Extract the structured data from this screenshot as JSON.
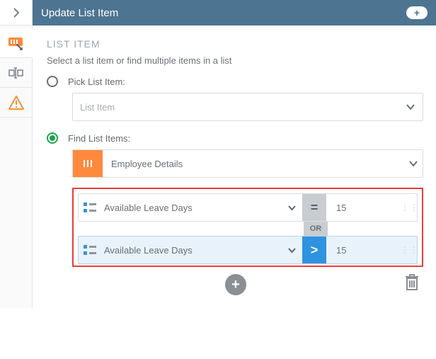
{
  "header": {
    "title": "Update List Item"
  },
  "section": {
    "title": "LIST ITEM",
    "description": "Select a list item or find multiple items in a list"
  },
  "options": {
    "pick": {
      "label": "Pick List Item:",
      "selected": false,
      "placeholder": "List Item"
    },
    "find": {
      "label": "Find List Items:",
      "selected": true
    }
  },
  "datasource": {
    "name": "Employee Details"
  },
  "conditions": {
    "joiner": "OR",
    "rows": [
      {
        "field": "Available Leave Days",
        "op": "=",
        "value": "15",
        "selected": false
      },
      {
        "field": "Available Leave Days",
        "op": ">",
        "value": "15",
        "selected": true
      }
    ]
  }
}
